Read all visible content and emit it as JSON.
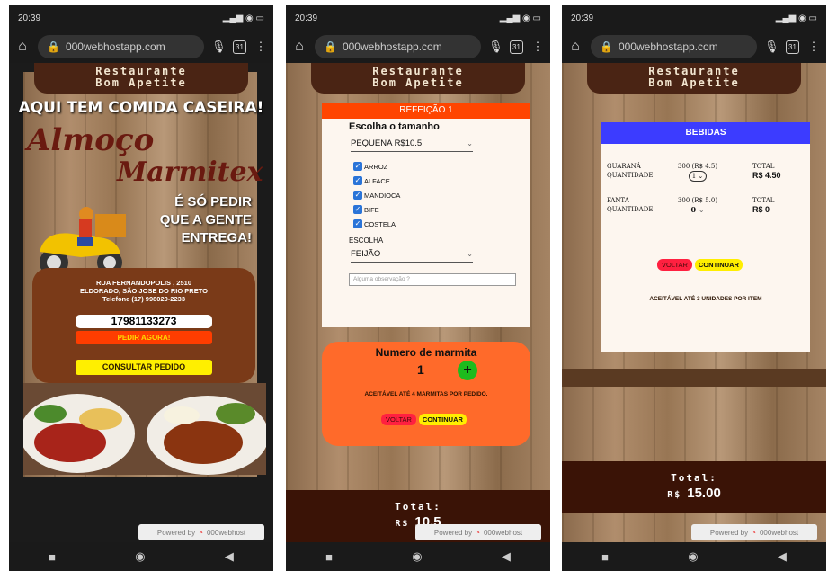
{
  "status": {
    "time": "20:39"
  },
  "browser": {
    "url": "000webhostapp.com"
  },
  "restaurant": {
    "line1": "Restaurante",
    "line2": "Bom Apetite"
  },
  "home": {
    "banner": "AQUI TEM COMIDA CASEIRA!",
    "script1": "Almoço",
    "script2": "Marmitex",
    "slogan1": "É SÓ PEDIR",
    "slogan2": "QUE A GENTE",
    "slogan3": "ENTREGA!",
    "address1": "RUA FERNANDOPOLIS , 2510",
    "address2": "ELDORADO, SÃO JOSE DO RIO PRETO",
    "address3": "Telefone (17) 998020-2233",
    "phone_value": "17981133273",
    "order_label": "PEDIR AGORA!",
    "consult_label": "CONSULTAR PEDIDO"
  },
  "meal": {
    "header": "REFEIÇÃO 1",
    "size_label": "Escolha o tamanho",
    "size_value": "PEQUENA R$10.5",
    "options": [
      "ARROZ",
      "ALFACE",
      "MANDIOCA",
      "BIFE",
      "COSTELA"
    ],
    "choice_label": "ESCOLHA",
    "choice_value": "FEIJÃO",
    "obs_placeholder": "Alguma observação ?",
    "count_title": "Numero de marmita",
    "count_value": "1",
    "plus_label": "+",
    "note": "ACEITÁVEL ATÉ 4 MARMITAS POR PEDIDO.",
    "back_label": "VOLTAR",
    "continue_label": "CONTINUAR",
    "total_label": "Total:",
    "currency": "R$",
    "total_value": "10.5"
  },
  "drinks": {
    "header": "BEBIDAS",
    "items": [
      {
        "name": "GUARANÁ",
        "qty_label": "QUANTIDADE",
        "price": "300 (R$ 4.5)",
        "qty": "1",
        "total_label": "TOTAL",
        "total": "R$ 4.50"
      },
      {
        "name": "FANTA",
        "qty_label": "QUANTIDADE",
        "price": "300 (R$ 5.0)",
        "qty": "0",
        "total_label": "TOTAL",
        "total": "R$ 0"
      }
    ],
    "back_label": "VOLTAR",
    "continue_label": "CONTINUAR",
    "note": "ACEITÁVEL ATÉ 3 UNIDADES POR ITEM",
    "total_label": "Total:",
    "currency": "R$",
    "total_value": "15.00"
  },
  "footer": {
    "powered": "Powered by",
    "brand": "000webhost"
  },
  "colors": {
    "brown": "#4a2414",
    "orange": "#ff4500",
    "blue": "#3c3cff",
    "yellow": "#ffef00"
  }
}
